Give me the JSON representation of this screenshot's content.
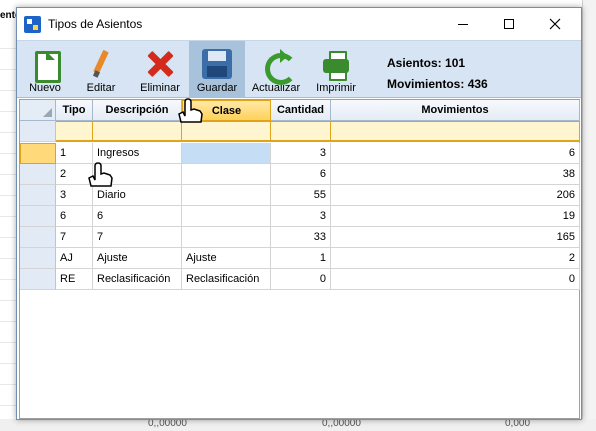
{
  "background": {
    "tab_label": "ente",
    "bottom_numbers": [
      "0,,00000",
      "0,,00000",
      "0,000"
    ]
  },
  "window": {
    "title": "Tipos de Asientos",
    "icon": "app-icon",
    "controls": [
      "minimize-icon",
      "maximize-icon",
      "close-icon"
    ]
  },
  "toolbar": {
    "buttons": [
      {
        "label": "Nuevo",
        "icon": "new-document-icon"
      },
      {
        "label": "Editar",
        "icon": "pencil-icon"
      },
      {
        "label": "Eliminar",
        "icon": "delete-x-icon"
      },
      {
        "label": "Guardar",
        "icon": "save-disk-icon"
      },
      {
        "label": "Actualizar",
        "icon": "refresh-icon"
      },
      {
        "label": "Imprimir",
        "icon": "printer-icon"
      }
    ],
    "asientos_label": "Asientos:",
    "asientos_value": "101",
    "movimientos_label": "Movimientos:",
    "movimientos_value": "436"
  },
  "grid": {
    "columns": [
      "Tipo",
      "Descripción",
      "Clase",
      "Cantidad",
      "Movimientos"
    ],
    "rows": [
      [
        "1",
        "Ingresos",
        "",
        "3",
        "6"
      ],
      [
        "2",
        "",
        "",
        "6",
        "38"
      ],
      [
        "3",
        "Diario",
        "",
        "55",
        "206"
      ],
      [
        "6",
        "6",
        "",
        "3",
        "19"
      ],
      [
        "7",
        "7",
        "",
        "33",
        "165"
      ],
      [
        "AJ",
        "Ajuste",
        "Ajuste",
        "1",
        "2"
      ],
      [
        "RE",
        "Reclasificación",
        "Reclasificación",
        "0",
        "0"
      ]
    ]
  },
  "colors": {
    "toolbar_bg": "#d6e4f3",
    "selected_header": "#ffd15a",
    "filter_row": "#fff5d0",
    "selected_cell": "#c6ddf6"
  }
}
